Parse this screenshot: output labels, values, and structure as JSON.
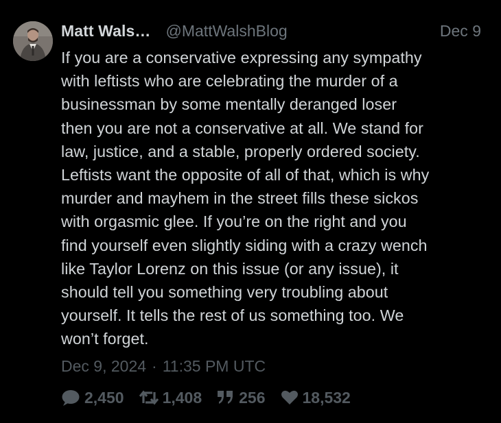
{
  "author": {
    "name": "Matt Wals…",
    "handle": "@MattWalshBlog",
    "avatar_icon": "profile-photo"
  },
  "tweet": {
    "date_short": "Dec 9",
    "text": "If you are a conservative expressing any sympathy\nwith leftists who are celebrating the murder of a\nbusinessman by some mentally deranged loser\nthen you are not a conservative at all. We stand for\nlaw, justice, and a stable, properly ordered society.\nLeftists want the opposite of all of that, which is why\nmurder and mayhem in the street fills these sickos\nwith orgasmic glee. If you’re on the right and you\nfind yourself even slightly siding with a crazy wench\nlike Taylor Lorenz on this issue (or any issue), it\nshould tell you something very troubling about\nyourself. It tells the rest of us something too. We\nwon’t forget.",
    "date": "Dec 9, 2024",
    "separator": "·",
    "time": "11:35 PM UTC"
  },
  "stats": {
    "replies": "2,450",
    "retweets": "1,408",
    "quotes": "256",
    "likes": "18,532"
  },
  "colors": {
    "background": "#000000",
    "text": "#d0d4d7",
    "muted": "#6d757c",
    "stats": "#535a60"
  }
}
